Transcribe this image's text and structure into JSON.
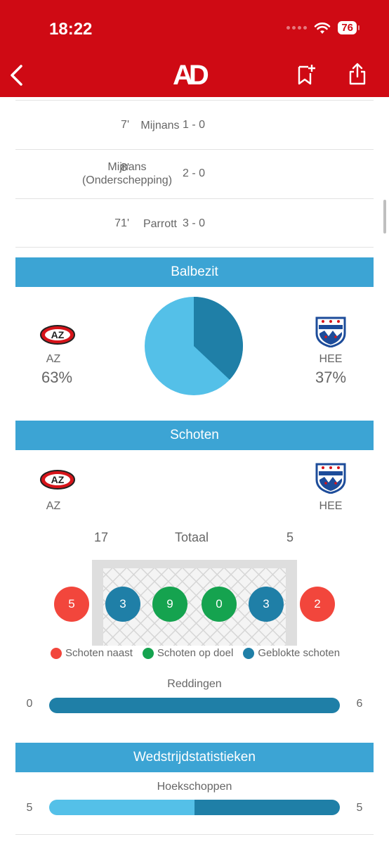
{
  "status": {
    "time": "18:22",
    "battery": "76"
  },
  "nav": {
    "logo": "AD"
  },
  "goals": [
    {
      "minute": "7'",
      "player": "Mijnans",
      "score": "1 - 0"
    },
    {
      "minute": "8'",
      "player": "Mijnans (Onderschepping)",
      "score": "2 - 0"
    },
    {
      "minute": "71'",
      "player": "Parrott",
      "score": "3 - 0"
    }
  ],
  "possession": {
    "title": "Balbezit",
    "home": {
      "code": "AZ",
      "pct": "63%",
      "value": 63
    },
    "away": {
      "code": "HEE",
      "pct": "37%",
      "value": 37
    }
  },
  "shots": {
    "title": "Schoten",
    "home_code": "AZ",
    "away_code": "HEE",
    "total_label": "Totaal",
    "home_total": "17",
    "away_total": "5",
    "home_off_target": "5",
    "home_blocked": "3",
    "home_on_target": "9",
    "away_on_target": "0",
    "away_blocked": "3",
    "away_off_target": "2",
    "legend": {
      "off_target": "Schoten naast",
      "on_target": "Schoten op doel",
      "blocked": "Geblokte schoten"
    },
    "saves_label": "Reddingen",
    "saves_home": "0",
    "saves_away": "6",
    "saves_home_value": 0,
    "saves_away_value": 6
  },
  "match_stats": {
    "title": "Wedstrijdstatistieken",
    "corners_label": "Hoekschoppen",
    "corners_home": "5",
    "corners_away": "5",
    "corners_home_value": 5,
    "corners_away_value": 5
  },
  "colors": {
    "header_red": "#cf0a14",
    "section_blue": "#3ca4d4",
    "home_light_blue": "#54c0e8",
    "away_dark_blue": "#1f7fa7",
    "off_target_red": "#f2463c",
    "on_target_green": "#15a34f",
    "blocked_blue": "#1f7fa7"
  }
}
